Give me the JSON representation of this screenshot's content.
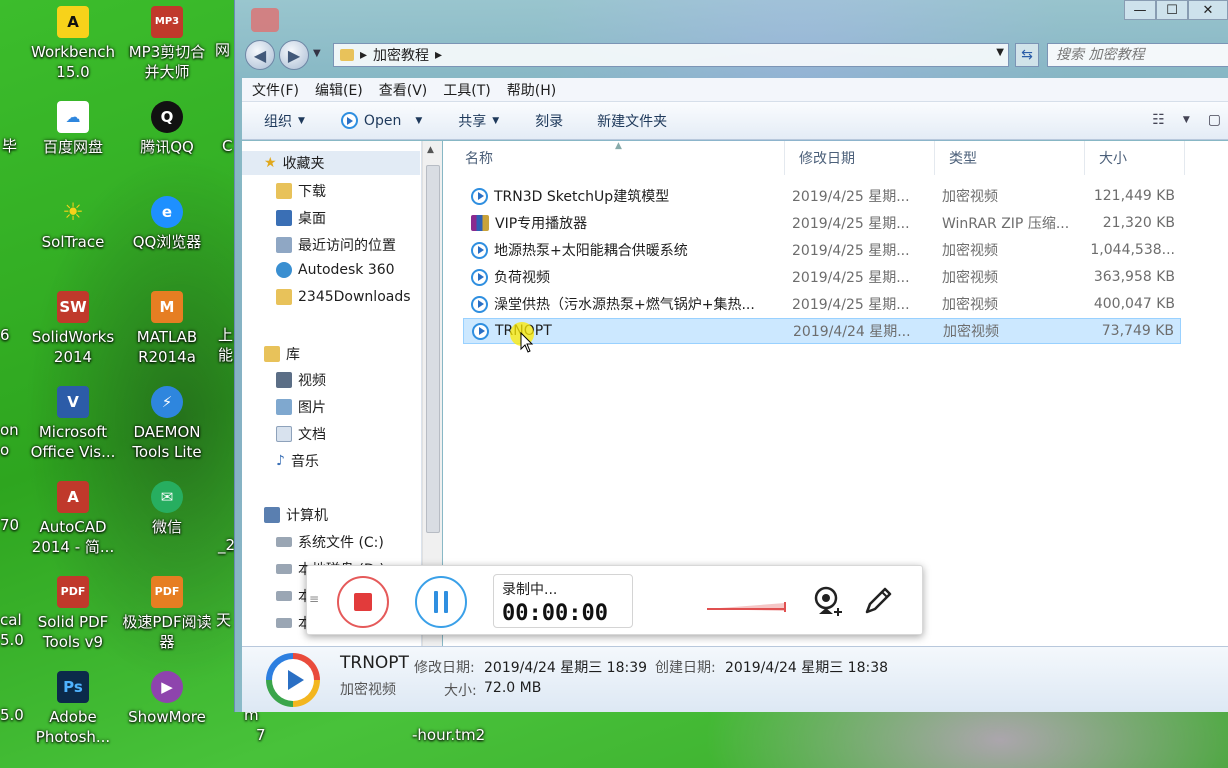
{
  "desktop": {
    "icons": [
      {
        "label1": "Workbench",
        "label2": "15.0",
        "color": "#111111",
        "glyph": "A"
      },
      {
        "label1": "MP3剪切合",
        "label2": "并大师",
        "color": "#c0392b",
        "glyph": "MP3"
      },
      {
        "label1": "百度网盘",
        "label2": "",
        "color": "#2e86de",
        "glyph": "☁"
      },
      {
        "label1": "腾讯QQ",
        "label2": "",
        "color": "#111111",
        "glyph": "Q"
      },
      {
        "label1": "SolTrace",
        "label2": "",
        "color": "#f1c40f",
        "glyph": "☀"
      },
      {
        "label1": "QQ浏览器",
        "label2": "",
        "color": "#1e90ff",
        "glyph": "e"
      },
      {
        "label1": "SolidWorks",
        "label2": "2014",
        "color": "#c0392b",
        "glyph": "SW"
      },
      {
        "label1": "MATLAB",
        "label2": "R2014a",
        "color": "#e67e22",
        "glyph": "M"
      },
      {
        "label1": "Microsoft",
        "label2": "Office Vis...",
        "color": "#2c5ca8",
        "glyph": "V"
      },
      {
        "label1": "DAEMON",
        "label2": "Tools Lite",
        "color": "#2e86de",
        "glyph": "⚡"
      },
      {
        "label1": "AutoCAD",
        "label2": "2014 - 简...",
        "color": "#c0392b",
        "glyph": "A"
      },
      {
        "label1": "微信",
        "label2": "",
        "color": "#27ae60",
        "glyph": "✉"
      },
      {
        "label1": "Solid PDF",
        "label2": "Tools v9",
        "color": "#c0392b",
        "glyph": "PDF"
      },
      {
        "label1": "极速PDF阅读",
        "label2": "器",
        "color": "#e67e22",
        "glyph": "PDF"
      },
      {
        "label1": "Adobe",
        "label2": "Photosh...",
        "color": "#0b2a4a",
        "glyph": "Ps"
      },
      {
        "label1": "ShowMore",
        "label2": "",
        "color": "#8e44ad",
        "glyph": "▶"
      }
    ],
    "partials": {
      "p1": "网",
      "p2": "毕",
      "p3": "C",
      "p4": "6",
      "p5": "上",
      "p6": "能",
      "p7": "on",
      "p8": "o",
      "p9": "70",
      "p10": "_2",
      "p11": "cal",
      "p12": "5.0",
      "p13": "天",
      "p14": "5.0",
      "p15": "m",
      "p16": "7",
      "p17": "-hour.tm2"
    }
  },
  "window": {
    "address_arrow": "▸",
    "address_path": "加密教程",
    "search_placeholder": "搜索 加密教程",
    "controls": {
      "minimize": "—",
      "maximize": "☐",
      "close": "✕"
    },
    "menu": [
      "文件(F)",
      "编辑(E)",
      "查看(V)",
      "工具(T)",
      "帮助(H)"
    ],
    "toolbar": {
      "organize": "组织",
      "open": "Open",
      "share": "共享",
      "burn": "刻录",
      "new_folder": "新建文件夹"
    },
    "nav": {
      "favorites": "收藏夹",
      "downloads": "下载",
      "desktop": "桌面",
      "recent": "最近访问的位置",
      "autodesk": "Autodesk 360",
      "downloads2345": "2345Downloads",
      "libraries": "库",
      "videos": "视频",
      "pictures": "图片",
      "documents": "文档",
      "music": "音乐",
      "computer": "计算机",
      "system_drive": "系统文件 (C:)",
      "local_drive_d": "本地磁盘 (D:)",
      "local_e": "本",
      "local_f": "本"
    },
    "columns": {
      "name": "名称",
      "date": "修改日期",
      "type": "类型",
      "size": "大小"
    },
    "files": [
      {
        "name": "TRN3D SketchUp建筑模型",
        "date": "2019/4/25 星期...",
        "type": "加密视频",
        "size": "121,449 KB",
        "icon": "play"
      },
      {
        "name": "VIP专用播放器",
        "date": "2019/4/25 星期...",
        "type": "WinRAR ZIP 压缩...",
        "size": "21,320 KB",
        "icon": "zip"
      },
      {
        "name": "地源热泵+太阳能耦合供暖系统",
        "date": "2019/4/25 星期...",
        "type": "加密视频",
        "size": "1,044,538...",
        "icon": "play"
      },
      {
        "name": "负荷视频",
        "date": "2019/4/25 星期...",
        "type": "加密视频",
        "size": "363,958 KB",
        "icon": "play"
      },
      {
        "name": "澡堂供热（污水源热泵+燃气锅炉+集热...",
        "date": "2019/4/25 星期...",
        "type": "加密视频",
        "size": "400,047 KB",
        "icon": "play"
      },
      {
        "name": "TRNOPT",
        "date": "2019/4/24 星期...",
        "type": "加密视频",
        "size": "73,749 KB",
        "icon": "play"
      }
    ],
    "details": {
      "name": "TRNOPT",
      "type": "加密视频",
      "modified_label": "修改日期:",
      "modified_value": "2019/4/24 星期三 18:39",
      "created_label": "创建日期:",
      "created_value": "2019/4/24 星期三 18:38",
      "size_label": "大小:",
      "size_value": "72.0 MB"
    }
  },
  "recorder": {
    "status": "录制中...",
    "time": "00:00:00"
  }
}
